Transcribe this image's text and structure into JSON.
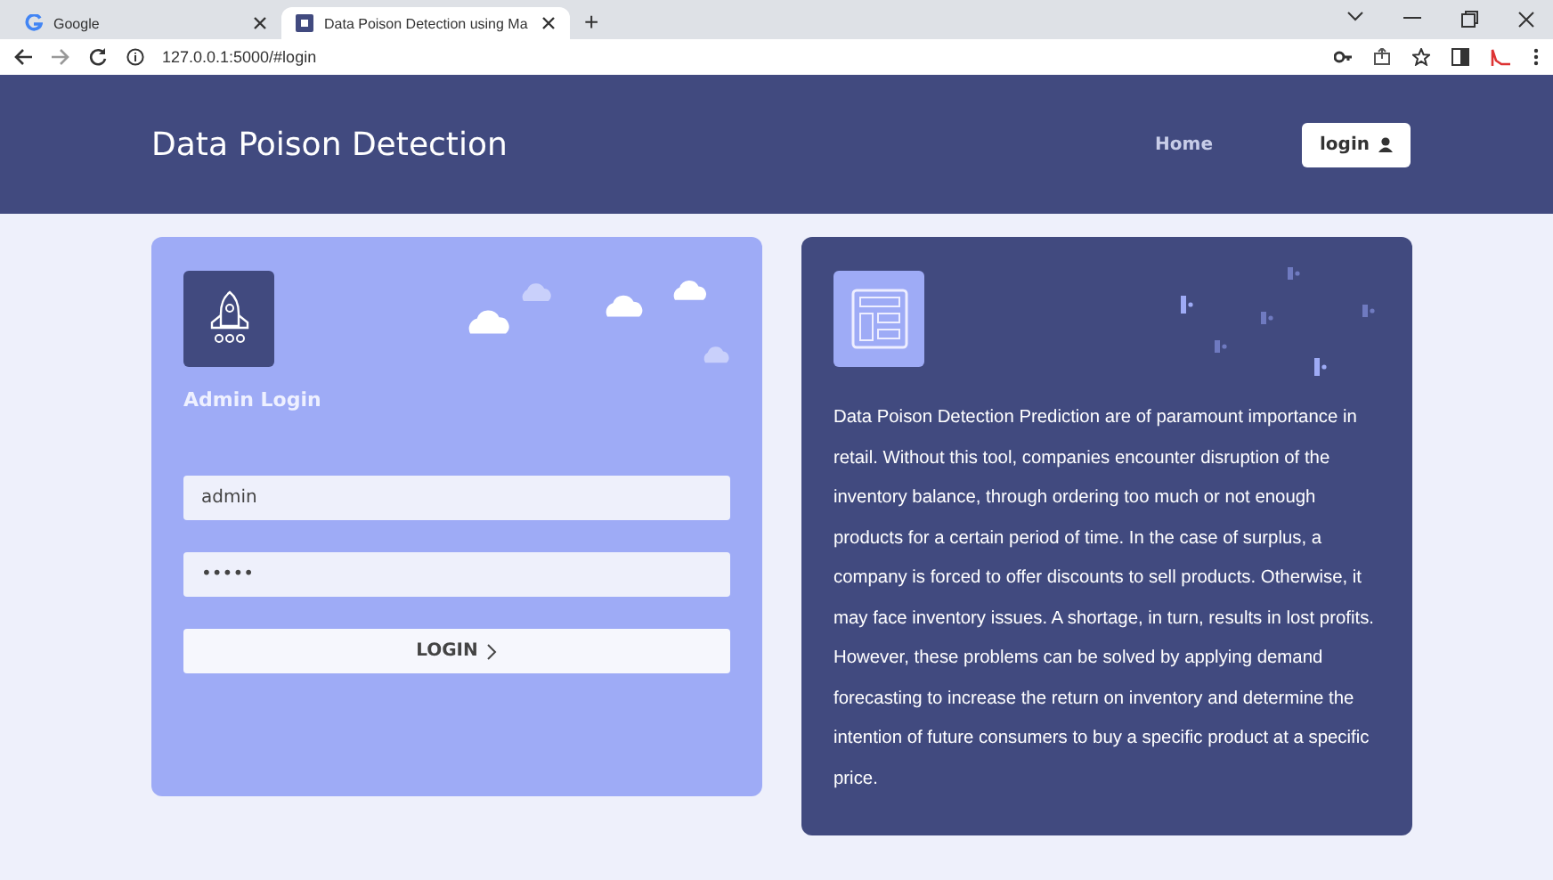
{
  "browser": {
    "tabs": [
      {
        "title": "Google",
        "selected": false
      },
      {
        "title": "Data Poison Detection using Ma",
        "selected": true
      }
    ],
    "new_tab": "+",
    "url": "127.0.0.1:5000/#login"
  },
  "header": {
    "brand": "Data Poison Detection",
    "nav": [
      {
        "label": "Home",
        "selected": false
      },
      {
        "label": "login",
        "selected": true
      }
    ]
  },
  "login": {
    "title": "Admin Login",
    "username": {
      "value": "admin"
    },
    "password": {
      "value": "•••••"
    },
    "button": "LOGIN"
  },
  "info": {
    "text": "Data Poison Detection Prediction are of paramount importance in retail. Without this tool, companies encounter disruption of the inventory balance, through ordering too much or not enough products for a certain period of time. In the case of surplus, a company is forced to offer discounts to sell products. Otherwise, it may face inventory issues. A shortage, in turn, results in lost profits. However, these problems can be solved by applying demand forecasting to increase the return on inventory and determine the intention of future consumers to buy a specific product at a specific price."
  }
}
